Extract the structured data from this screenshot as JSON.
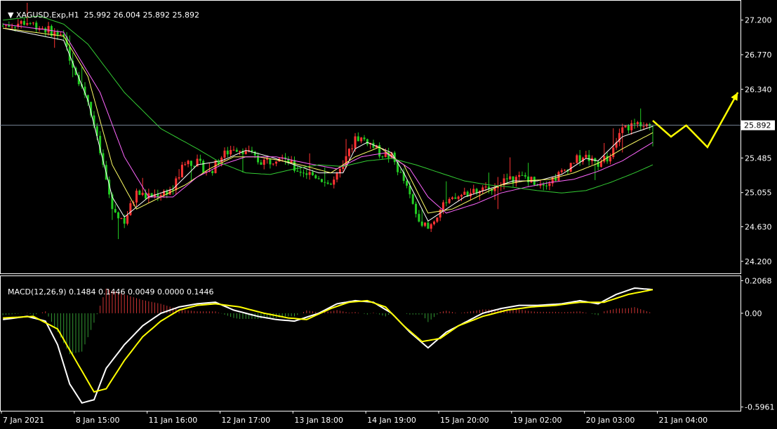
{
  "header": {
    "symbol": "XAGUSD.Exp,H1",
    "ohlc": "25.992 26.004 25.892 25.892"
  },
  "macd_header": {
    "text": "MACD(12,26,9) 0.1484 0.1446 0.0049 0.0000 0.1446"
  },
  "colors": {
    "background": "#000000",
    "frame": "#ffffff",
    "bull_candle": "#ff3333",
    "bear_candle": "#22cc22",
    "ma_fast": "#ffffff",
    "ma_mid": "#ffff66",
    "ma_slow": "#ff66ff",
    "ma_long": "#33cc33",
    "forecast_arrow": "#ffff00",
    "macd_line": "#ffffff",
    "signal_line": "#ffff00",
    "hist_pos": "#cc3333",
    "hist_neg": "#339933"
  },
  "chart_data": [
    {
      "type": "candlestick",
      "title": "XAGUSD.Exp,H1",
      "ylim": [
        24.05,
        27.45
      ],
      "yticks": [
        "27.200",
        "26.770",
        "26.340",
        "25.485",
        "25.055",
        "24.630",
        "24.200"
      ],
      "current_price": "25.892",
      "x_labels": [
        "7 Jan 2021",
        "8 Jan 15:00",
        "11 Jan 16:00",
        "12 Jan 17:00",
        "13 Jan 18:00",
        "14 Jan 19:00",
        "15 Jan 20:00",
        "19 Jan 02:00",
        "20 Jan 03:00",
        "21 Jan 04:00"
      ],
      "price_path_anchors": [
        [
          0,
          27.13
        ],
        [
          8,
          27.18
        ],
        [
          16,
          27.06
        ],
        [
          20,
          26.95
        ],
        [
          24,
          26.55
        ],
        [
          28,
          26.2
        ],
        [
          32,
          25.55
        ],
        [
          36,
          24.85
        ],
        [
          40,
          24.7
        ],
        [
          44,
          25.05
        ],
        [
          48,
          25.0
        ],
        [
          52,
          25.05
        ],
        [
          56,
          25.1
        ],
        [
          60,
          25.45
        ],
        [
          64,
          25.42
        ],
        [
          68,
          25.3
        ],
        [
          72,
          25.5
        ],
        [
          76,
          25.62
        ],
        [
          80,
          25.58
        ],
        [
          84,
          25.45
        ],
        [
          88,
          25.45
        ],
        [
          92,
          25.55
        ],
        [
          96,
          25.35
        ],
        [
          100,
          25.3
        ],
        [
          104,
          25.25
        ],
        [
          108,
          25.15
        ],
        [
          112,
          25.35
        ],
        [
          116,
          25.75
        ],
        [
          120,
          25.7
        ],
        [
          124,
          25.55
        ],
        [
          128,
          25.5
        ],
        [
          132,
          25.2
        ],
        [
          136,
          24.8
        ],
        [
          140,
          24.6
        ],
        [
          144,
          24.85
        ],
        [
          148,
          24.95
        ],
        [
          152,
          25.05
        ],
        [
          156,
          25.05
        ],
        [
          160,
          25.1
        ],
        [
          164,
          25.2
        ],
        [
          168,
          25.22
        ],
        [
          172,
          25.25
        ],
        [
          176,
          25.18
        ],
        [
          180,
          25.2
        ],
        [
          184,
          25.3
        ],
        [
          188,
          25.45
        ],
        [
          192,
          25.5
        ],
        [
          196,
          25.42
        ],
        [
          200,
          25.5
        ],
        [
          204,
          25.85
        ],
        [
          208,
          25.9
        ],
        [
          212,
          25.95
        ],
        [
          214,
          25.89
        ]
      ],
      "moving_averages": [
        {
          "color": "#ffffff",
          "anchors": [
            [
              0,
              27.1
            ],
            [
              20,
              26.95
            ],
            [
              28,
              26.2
            ],
            [
              36,
              25.0
            ],
            [
              40,
              24.75
            ],
            [
              48,
              25.0
            ],
            [
              56,
              25.1
            ],
            [
              64,
              25.4
            ],
            [
              72,
              25.45
            ],
            [
              80,
              25.58
            ],
            [
              88,
              25.5
            ],
            [
              96,
              25.4
            ],
            [
              104,
              25.3
            ],
            [
              112,
              25.3
            ],
            [
              116,
              25.6
            ],
            [
              120,
              25.68
            ],
            [
              128,
              25.55
            ],
            [
              132,
              25.3
            ],
            [
              140,
              24.7
            ],
            [
              144,
              24.8
            ],
            [
              152,
              25.0
            ],
            [
              160,
              25.1
            ],
            [
              168,
              25.2
            ],
            [
              176,
              25.2
            ],
            [
              184,
              25.28
            ],
            [
              192,
              25.48
            ],
            [
              196,
              25.45
            ],
            [
              204,
              25.75
            ],
            [
              214,
              25.88
            ]
          ]
        },
        {
          "color": "#ffff66",
          "anchors": [
            [
              0,
              27.1
            ],
            [
              20,
              27.0
            ],
            [
              28,
              26.5
            ],
            [
              36,
              25.4
            ],
            [
              44,
              24.85
            ],
            [
              52,
              25.0
            ],
            [
              60,
              25.15
            ],
            [
              68,
              25.35
            ],
            [
              76,
              25.5
            ],
            [
              84,
              25.5
            ],
            [
              92,
              25.45
            ],
            [
              100,
              25.38
            ],
            [
              108,
              25.3
            ],
            [
              116,
              25.5
            ],
            [
              124,
              25.62
            ],
            [
              132,
              25.4
            ],
            [
              140,
              24.8
            ],
            [
              148,
              24.85
            ],
            [
              156,
              25.0
            ],
            [
              164,
              25.15
            ],
            [
              172,
              25.2
            ],
            [
              180,
              25.22
            ],
            [
              188,
              25.3
            ],
            [
              196,
              25.42
            ],
            [
              204,
              25.6
            ],
            [
              214,
              25.8
            ]
          ]
        },
        {
          "color": "#ff66ff",
          "anchors": [
            [
              0,
              27.15
            ],
            [
              20,
              27.05
            ],
            [
              32,
              26.3
            ],
            [
              40,
              25.5
            ],
            [
              48,
              25.0
            ],
            [
              56,
              25.0
            ],
            [
              64,
              25.25
            ],
            [
              72,
              25.4
            ],
            [
              80,
              25.5
            ],
            [
              90,
              25.5
            ],
            [
              100,
              25.42
            ],
            [
              110,
              25.35
            ],
            [
              118,
              25.5
            ],
            [
              126,
              25.55
            ],
            [
              134,
              25.35
            ],
            [
              140,
              25.0
            ],
            [
              146,
              24.8
            ],
            [
              156,
              24.92
            ],
            [
              164,
              25.05
            ],
            [
              172,
              25.12
            ],
            [
              180,
              25.18
            ],
            [
              188,
              25.22
            ],
            [
              196,
              25.32
            ],
            [
              204,
              25.45
            ],
            [
              214,
              25.68
            ]
          ]
        },
        {
          "color": "#33cc33",
          "anchors": [
            [
              0,
              27.2
            ],
            [
              12,
              27.25
            ],
            [
              20,
              27.15
            ],
            [
              28,
              26.9
            ],
            [
              40,
              26.3
            ],
            [
              52,
              25.85
            ],
            [
              64,
              25.6
            ],
            [
              72,
              25.42
            ],
            [
              80,
              25.3
            ],
            [
              88,
              25.28
            ],
            [
              96,
              25.35
            ],
            [
              104,
              25.4
            ],
            [
              112,
              25.38
            ],
            [
              120,
              25.45
            ],
            [
              128,
              25.48
            ],
            [
              136,
              25.4
            ],
            [
              144,
              25.3
            ],
            [
              152,
              25.2
            ],
            [
              160,
              25.15
            ],
            [
              168,
              25.12
            ],
            [
              176,
              25.08
            ],
            [
              184,
              25.05
            ],
            [
              192,
              25.08
            ],
            [
              200,
              25.18
            ],
            [
              208,
              25.3
            ],
            [
              214,
              25.4
            ]
          ]
        }
      ],
      "forecast_path": [
        [
          214,
          25.95
        ],
        [
          220,
          25.75
        ],
        [
          225,
          25.89
        ],
        [
          232,
          25.62
        ],
        [
          242,
          26.3
        ]
      ]
    },
    {
      "type": "macd",
      "title": "MACD(12,26,9)",
      "ylim": [
        -0.62,
        0.24
      ],
      "yticks": [
        "0.2068",
        "0.00",
        "-0.5961"
      ],
      "macd_anchors": [
        [
          0,
          -0.04
        ],
        [
          8,
          -0.02
        ],
        [
          14,
          -0.05
        ],
        [
          18,
          -0.2
        ],
        [
          22,
          -0.45
        ],
        [
          26,
          -0.57
        ],
        [
          30,
          -0.55
        ],
        [
          34,
          -0.35
        ],
        [
          40,
          -0.2
        ],
        [
          46,
          -0.08
        ],
        [
          52,
          0.0
        ],
        [
          58,
          0.04
        ],
        [
          64,
          0.06
        ],
        [
          70,
          0.07
        ],
        [
          76,
          0.02
        ],
        [
          84,
          -0.02
        ],
        [
          90,
          -0.04
        ],
        [
          96,
          -0.05
        ],
        [
          104,
          0.0
        ],
        [
          110,
          0.06
        ],
        [
          116,
          0.08
        ],
        [
          122,
          0.07
        ],
        [
          128,
          0.0
        ],
        [
          134,
          -0.12
        ],
        [
          140,
          -0.22
        ],
        [
          146,
          -0.12
        ],
        [
          152,
          -0.06
        ],
        [
          158,
          0.0
        ],
        [
          164,
          0.03
        ],
        [
          170,
          0.05
        ],
        [
          176,
          0.05
        ],
        [
          184,
          0.06
        ],
        [
          190,
          0.08
        ],
        [
          196,
          0.06
        ],
        [
          202,
          0.12
        ],
        [
          208,
          0.16
        ],
        [
          214,
          0.15
        ]
      ],
      "signal_anchors": [
        [
          0,
          -0.03
        ],
        [
          10,
          -0.02
        ],
        [
          18,
          -0.1
        ],
        [
          24,
          -0.3
        ],
        [
          30,
          -0.5
        ],
        [
          34,
          -0.48
        ],
        [
          40,
          -0.3
        ],
        [
          46,
          -0.15
        ],
        [
          52,
          -0.05
        ],
        [
          58,
          0.02
        ],
        [
          64,
          0.05
        ],
        [
          70,
          0.06
        ],
        [
          78,
          0.04
        ],
        [
          86,
          0.0
        ],
        [
          94,
          -0.03
        ],
        [
          100,
          -0.04
        ],
        [
          108,
          0.03
        ],
        [
          114,
          0.07
        ],
        [
          120,
          0.08
        ],
        [
          126,
          0.04
        ],
        [
          132,
          -0.08
        ],
        [
          138,
          -0.18
        ],
        [
          144,
          -0.16
        ],
        [
          150,
          -0.08
        ],
        [
          158,
          -0.02
        ],
        [
          166,
          0.02
        ],
        [
          174,
          0.04
        ],
        [
          182,
          0.05
        ],
        [
          190,
          0.07
        ],
        [
          198,
          0.07
        ],
        [
          206,
          0.12
        ],
        [
          214,
          0.15
        ]
      ]
    }
  ]
}
